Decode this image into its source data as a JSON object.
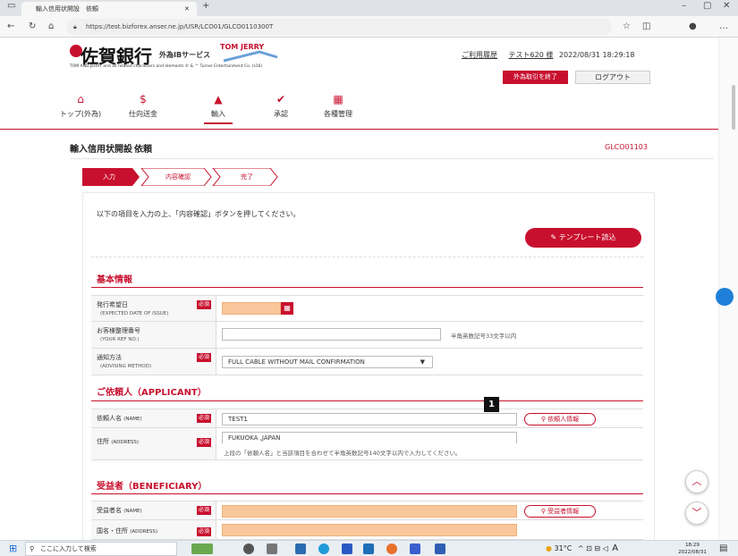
{
  "browser": {
    "tab_title": "輸入信用状開設　依頼",
    "url": "https://test.bizforex.anser.ne.jp/USR/LCO01/GLCO0110300T"
  },
  "header": {
    "logo_text": "佐賀銀行",
    "logo_sub": "TOM AND JERRY and all related characters and elements © & ™ Turner Entertainment Co. (s16)",
    "logo_tagline": "外為IBサービス",
    "history_link": "ご利用履歴",
    "user_name": "テスト620 様",
    "datetime": "2022/08/31 18:29:18",
    "exit_button": "外為取引を終了",
    "logout_button": "ログアウト"
  },
  "nav": [
    {
      "label": "トップ(外為)",
      "icon": "home-icon",
      "glyph": "⌂"
    },
    {
      "label": "仕向送金",
      "icon": "remittance-icon",
      "glyph": "$"
    },
    {
      "label": "輸入",
      "icon": "import-icon",
      "glyph": "▲",
      "active": true
    },
    {
      "label": "承認",
      "icon": "approval-icon",
      "glyph": "✔"
    },
    {
      "label": "各種管理",
      "icon": "management-icon",
      "glyph": "▦"
    }
  ],
  "page": {
    "title": "輸入信用状開設",
    "subtitle": "依頼",
    "code": "GLCO01103"
  },
  "steps": [
    {
      "label": "入力",
      "active": true
    },
    {
      "label": "内容確認",
      "active": false
    },
    {
      "label": "完了",
      "active": false
    }
  ],
  "instruction": "以下の項目を入力の上、「内容確認」ボタンを押してください。",
  "template_button": "テンプレート読込",
  "sections": {
    "basic": "基本情報",
    "applicant": "ご依頼人（APPLICANT）",
    "beneficiary": "受益者（BENEFICIARY）"
  },
  "required_label": "必須",
  "fields": {
    "issue_date": {
      "jp": "発行希望日",
      "en": "(EXPECTED DATE OF ISSUE)",
      "value": ""
    },
    "ref_no": {
      "jp": "お客様整理番号",
      "en": "(YOUR REF NO.)",
      "value": "",
      "note": "半角英数記号33文字以内"
    },
    "advising": {
      "jp": "通知方法",
      "en": "(ADVISING METHOD)",
      "value": "FULL CABLE WITHOUT MAIL CONFIRMATION"
    },
    "applicant_name": {
      "jp": "依頼人名",
      "en": "(NAME)",
      "value": "TEST1",
      "button": "依頼人情報"
    },
    "applicant_address": {
      "jp": "住所",
      "en": "(ADDRESS)",
      "value": "FUKUOKA ,JAPAN",
      "note": "上段の「依頼人名」と当該項目を合わせて半角英数記号140文字以内で入力してください。"
    },
    "beneficiary_name": {
      "jp": "受益者名",
      "en": "(NAME)",
      "value": "",
      "button": "受益者情報"
    },
    "beneficiary_address": {
      "jp": "国名・住所",
      "en": "(ADDRESS)",
      "value": ""
    }
  },
  "annotation_badge": "1",
  "taskbar": {
    "search_placeholder": "ここに入力して検索",
    "weather": "31°C",
    "ime": "A",
    "time": "18:29",
    "date": "2022/08/31"
  }
}
